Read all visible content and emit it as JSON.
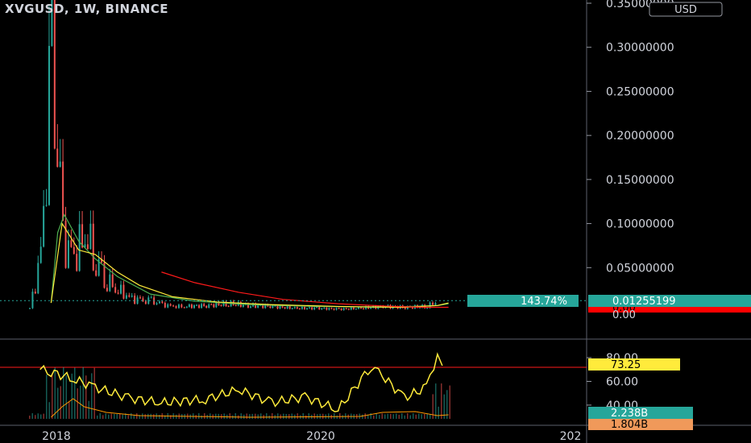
{
  "header": {
    "title": "XVGUSD, 1W, BINANCE"
  },
  "price_scale": {
    "currency": "USD",
    "ticks": [
      "0.35000000",
      "0.30000000",
      "0.25000000",
      "0.20000000",
      "0.15000000",
      "0.10000000",
      "0.05000000"
    ],
    "tick_values": [
      0.35,
      0.3,
      0.25,
      0.2,
      0.15,
      0.1,
      0.05
    ],
    "overlapping_labels": [
      "0.00",
      "0.00"
    ],
    "last_price_label": "0.01255199",
    "change_label": "143.74%",
    "ma_label": "0.00"
  },
  "indicator_scale": {
    "ticks": [
      "80.00",
      "60.00",
      "40.00"
    ],
    "tick_values": [
      80,
      60,
      40
    ],
    "rsi_label": "73.25",
    "volume_label": "2.238B",
    "volume_ma_label": "1.804B"
  },
  "time_axis": {
    "labels": [
      "2018",
      "2020",
      "202"
    ]
  },
  "colors": {
    "background": "#000000",
    "up": "#26a69a",
    "down": "#ef5350",
    "ma_fast": "#ffeb3b",
    "ma_slow": "#ff1a1a",
    "ma_mid": "#4caf50",
    "rsi": "#ffeb3b",
    "volume_ma": "#ff9800",
    "label_green": "#26a69a",
    "label_yellow": "#ffeb3b",
    "label_orange": "#f0995a",
    "label_red": "#ff0000"
  },
  "chart_data": {
    "type": "candlestick",
    "title": "XVGUSD, 1W, BINANCE",
    "ylim": [
      0,
      0.35
    ],
    "x_range": [
      "2017-11",
      "2021-01"
    ],
    "price_series": {
      "x": [
        "2017-11",
        "2017-12",
        "2018-01",
        "2018-02",
        "2018-03",
        "2018-04",
        "2018-05",
        "2018-06",
        "2018-07",
        "2018-08",
        "2018-09",
        "2018-10",
        "2018-11",
        "2018-12",
        "2019-01",
        "2019-03",
        "2019-05",
        "2019-07",
        "2019-09",
        "2019-11",
        "2020-01",
        "2020-03",
        "2020-05",
        "2020-07",
        "2020-09",
        "2020-11",
        "2020-12"
      ],
      "close": [
        0.004,
        0.06,
        0.28,
        0.08,
        0.06,
        0.09,
        0.06,
        0.035,
        0.025,
        0.016,
        0.012,
        0.012,
        0.008,
        0.006,
        0.006,
        0.007,
        0.009,
        0.007,
        0.006,
        0.004,
        0.004,
        0.003,
        0.004,
        0.006,
        0.005,
        0.006,
        0.0126
      ]
    },
    "rsi": {
      "x": [
        "2017-12",
        "2018-01",
        "2018-03",
        "2018-05",
        "2018-08",
        "2018-11",
        "2019-03",
        "2019-06",
        "2019-09",
        "2019-12",
        "2020-03",
        "2020-06",
        "2020-07",
        "2020-09",
        "2020-11",
        "2020-12"
      ],
      "values": [
        70,
        68,
        62,
        55,
        46,
        42,
        45,
        53,
        42,
        47,
        36,
        73,
        65,
        46,
        55,
        83
      ],
      "last": 73.25,
      "ylim": [
        25,
        95
      ]
    },
    "volume": {
      "last": "2.238B",
      "ma_last": "1.804B"
    }
  }
}
